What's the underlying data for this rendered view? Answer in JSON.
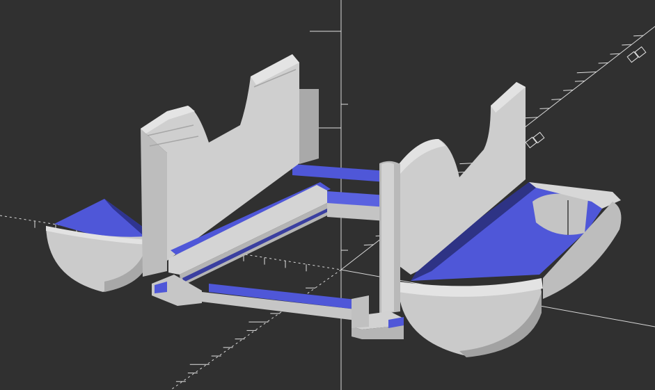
{
  "app": {
    "title": "",
    "view": "3D viewport"
  },
  "viewport": {
    "background_color": "#303030",
    "axes_color": "#d6d6d6",
    "tick_color": "#dedede",
    "model_main_color": "#c9c9c9",
    "model_light_color": "#dcdcdc",
    "model_dark_color": "#9e9e9e",
    "model_inner_color": "#4f57d8",
    "model_inner_dark_color": "#2e3385"
  },
  "icons": [
    "axis-label-icon"
  ]
}
